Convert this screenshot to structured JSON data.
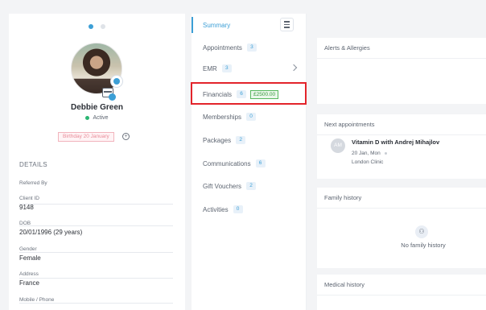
{
  "profile": {
    "name": "Debbie Green",
    "status": "Active",
    "birthday": "Birthday 20 January",
    "details_title": "DETAILS",
    "fields": [
      {
        "label": "Referred By",
        "value": ""
      },
      {
        "label": "Client ID",
        "value": "9148"
      },
      {
        "label": "DOB",
        "value": "20/01/1996 (29 years)"
      },
      {
        "label": "Gender",
        "value": "Female"
      },
      {
        "label": "Address",
        "value": "France"
      },
      {
        "label": "Mobile / Phone",
        "value": ""
      }
    ]
  },
  "nav": {
    "items": [
      {
        "label": "Summary"
      },
      {
        "label": "Appointments",
        "count": "3"
      },
      {
        "label": "EMR",
        "count": "3"
      },
      {
        "label": "Financials",
        "count": "6",
        "amount": "£2500.00"
      },
      {
        "label": "Memberships",
        "count": "0"
      },
      {
        "label": "Packages",
        "count": "2"
      },
      {
        "label": "Communications",
        "count": "6"
      },
      {
        "label": "Gift Vouchers",
        "count": "2"
      },
      {
        "label": "Activities",
        "count": "0"
      }
    ]
  },
  "panels": {
    "alerts_title": "Alerts & Allergies",
    "next_title": "Next appointments",
    "appointment": {
      "initials": "AM",
      "title": "Vitamin D with Andrej Mihajlov",
      "date": "20 Jan, Mon",
      "location": "London Clinic"
    },
    "family_title": "Family history",
    "family_empty": "No family history",
    "medical_title": "Medical history"
  },
  "colors": {
    "accent": "#3c9fd6",
    "active_status": "#2bb673",
    "highlight_box": "#e3242b",
    "money_green": "#3a9a41"
  }
}
